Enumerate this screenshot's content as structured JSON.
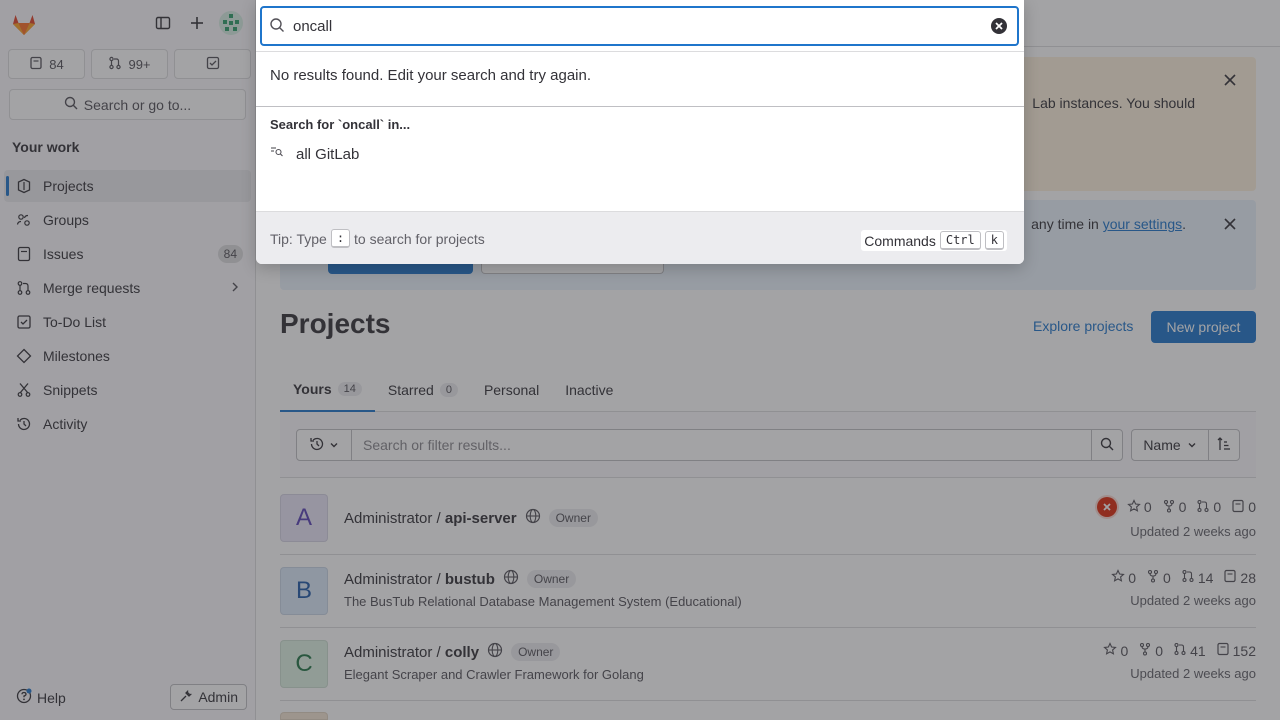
{
  "sidebar": {
    "counts": {
      "issues": "84",
      "merge_requests": "99+"
    },
    "search_label": "Search or go to...",
    "section_title": "Your work",
    "items": [
      {
        "label": "Projects",
        "icon": "project-icon"
      },
      {
        "label": "Groups",
        "icon": "group-icon"
      },
      {
        "label": "Issues",
        "icon": "issues-icon",
        "badge": "84"
      },
      {
        "label": "Merge requests",
        "icon": "merge-request-icon"
      },
      {
        "label": "To-Do List",
        "icon": "todo-icon"
      },
      {
        "label": "Milestones",
        "icon": "milestone-icon"
      },
      {
        "label": "Snippets",
        "icon": "snippet-icon"
      },
      {
        "label": "Activity",
        "icon": "history-icon"
      }
    ],
    "help_label": "Help",
    "admin_label": "Admin"
  },
  "alerts": {
    "warning_text": "Lab instances. You should",
    "info_text": "any time in",
    "info_link": "your settings",
    "info_suffix": "."
  },
  "page": {
    "title": "Projects",
    "explore_label": "Explore projects",
    "new_project_label": "New project",
    "tabs": [
      {
        "label": "Yours",
        "count": "14"
      },
      {
        "label": "Starred",
        "count": "0"
      },
      {
        "label": "Personal"
      },
      {
        "label": "Inactive"
      }
    ],
    "filter_placeholder": "Search or filter results...",
    "sort_label": "Name"
  },
  "projects": [
    {
      "avatar": "A",
      "namespace": "Administrator / ",
      "name": "api-server",
      "role": "Owner",
      "description": "",
      "stars": "0",
      "forks": "0",
      "mrs": "0",
      "issues": "0",
      "updated": "Updated 2 weeks ago",
      "avatar_bg": "#e9e6f8",
      "avatar_color": "#5943b6",
      "pipeline_failed": true
    },
    {
      "avatar": "B",
      "namespace": "Administrator / ",
      "name": "bustub",
      "role": "Owner",
      "description": "The BusTub Relational Database Management System (Educational)",
      "stars": "0",
      "forks": "0",
      "mrs": "14",
      "issues": "28",
      "updated": "Updated 2 weeks ago",
      "avatar_bg": "#dbe9f9",
      "avatar_color": "#1f5aa8",
      "pipeline_failed": false
    },
    {
      "avatar": "C",
      "namespace": "Administrator / ",
      "name": "colly",
      "role": "Owner",
      "description": "Elegant Scraper and Crawler Framework for Golang",
      "stars": "0",
      "forks": "0",
      "mrs": "41",
      "issues": "152",
      "updated": "Updated 2 weeks ago",
      "avatar_bg": "#dff2e4",
      "avatar_color": "#217645",
      "pipeline_failed": false
    }
  ],
  "search_modal": {
    "query": "oncall",
    "no_results": "No results found. Edit your search and try again.",
    "search_for": "Search for `oncall` in...",
    "scope_label": "all GitLab",
    "tip_prefix": "Tip: Type",
    "tip_key": ":",
    "tip_suffix": "to search for projects",
    "commands_label": "Commands",
    "commands_keys": [
      "Ctrl",
      "k"
    ]
  },
  "colors": {
    "accent": "#1f75cb",
    "overlay": "rgba(51,50,56,0.45)",
    "danger": "#dd2b0e"
  }
}
